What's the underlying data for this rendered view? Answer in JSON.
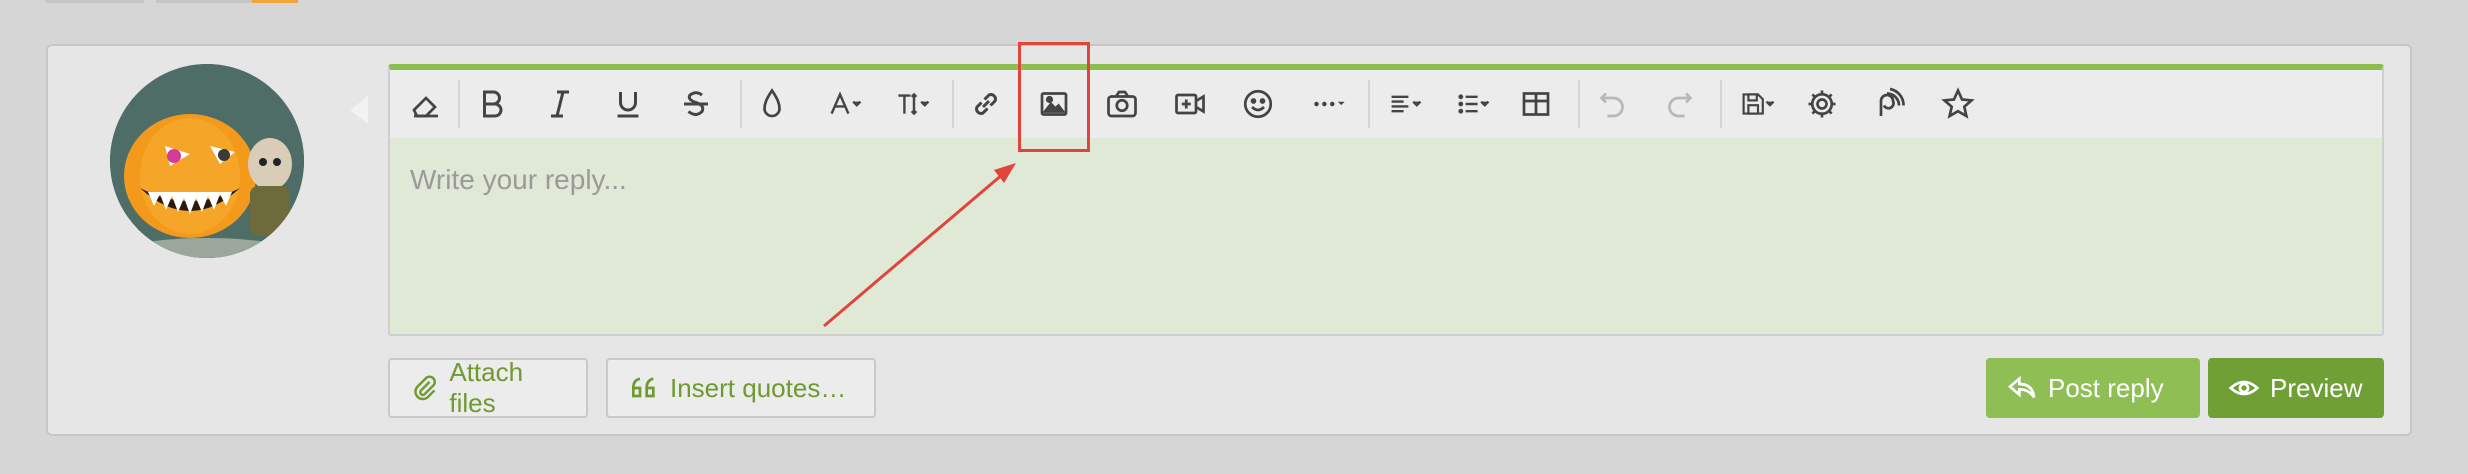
{
  "editor": {
    "placeholder": "Write your reply...",
    "accent_color": "#8bbf4f",
    "toolbar_icons": [
      "eraser-icon",
      "bold-icon",
      "italic-icon",
      "underline-icon",
      "strikethrough-icon",
      "text-color-icon",
      "font-family-icon",
      "font-size-icon",
      "link-icon",
      "image-icon",
      "camera-icon",
      "video-icon",
      "emoji-icon",
      "more-icon",
      "align-icon",
      "list-icon",
      "table-icon",
      "undo-icon",
      "redo-icon",
      "drafts-icon",
      "settings-icon",
      "toggle-bbcode-icon",
      "favorite-icon"
    ]
  },
  "actions": {
    "attach_files": "Attach files",
    "insert_quotes": "Insert quotes…",
    "post_reply": "Post reply",
    "preview": "Preview"
  },
  "colors": {
    "highlight": "#e0443b",
    "primary_button": "#8fbe55",
    "preview_button": "#6f9f35"
  }
}
